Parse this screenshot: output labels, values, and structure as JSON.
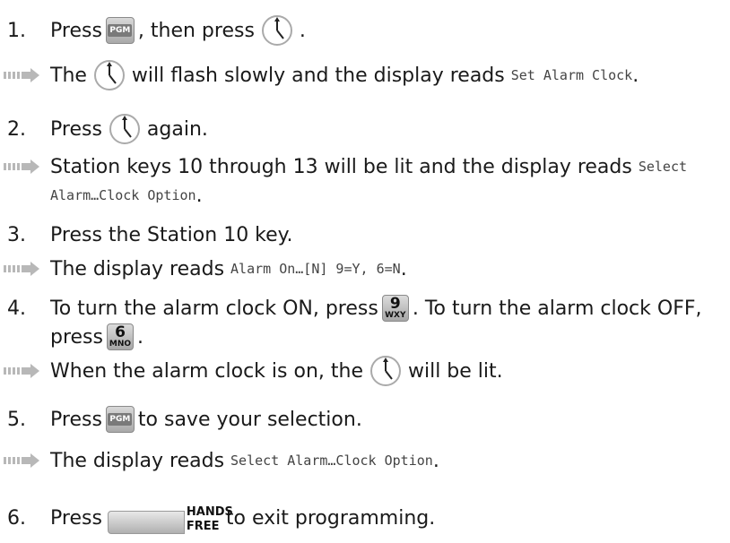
{
  "steps": [
    {
      "n": "1.",
      "pre": "Press",
      "mid": ", then press",
      "post": "."
    },
    {
      "n": "2.",
      "pre": "Press",
      "post": "again."
    },
    {
      "n": "3.",
      "text": "Press the Station 10 key."
    },
    {
      "n": "4.",
      "pre": "To turn the alarm clock ON, press",
      "mid": ". To turn the alarm clock OFF,",
      "cont": "press",
      "post": "."
    },
    {
      "n": "5.",
      "pre": "Press",
      "post": "to save your selection."
    },
    {
      "n": "6.",
      "pre": "Press",
      "post": "to exit programming."
    }
  ],
  "results": [
    {
      "pre": "The",
      "mid": "will flash slowly and the display reads",
      "display": "Set Alarm Clock",
      "post": "."
    },
    {
      "line1": "Station keys 10 through 13 will be lit and the display reads",
      "display1": "Select",
      "display2": "Alarm…Clock Option",
      "post": "."
    },
    {
      "pre": "The display reads",
      "display": "Alarm On…[N] 9=Y, 6=N",
      "post": "."
    },
    {
      "pre": "When the alarm clock is on, the",
      "post": "will be lit."
    },
    {
      "pre": "The display reads",
      "display": "Select Alarm…Clock Option",
      "post": "."
    }
  ],
  "keys": {
    "pgm": "PGM",
    "nine_digit": "9",
    "nine_letters": "WXY",
    "six_digit": "6",
    "six_letters": "MNO",
    "hands_line1": "HANDS",
    "hands_line2": "FREE"
  },
  "icons": [
    "pgm-key-icon",
    "alarm-clock-icon",
    "result-arrow-icon",
    "keypad-9-icon",
    "keypad-6-icon",
    "hands-free-key-icon"
  ]
}
